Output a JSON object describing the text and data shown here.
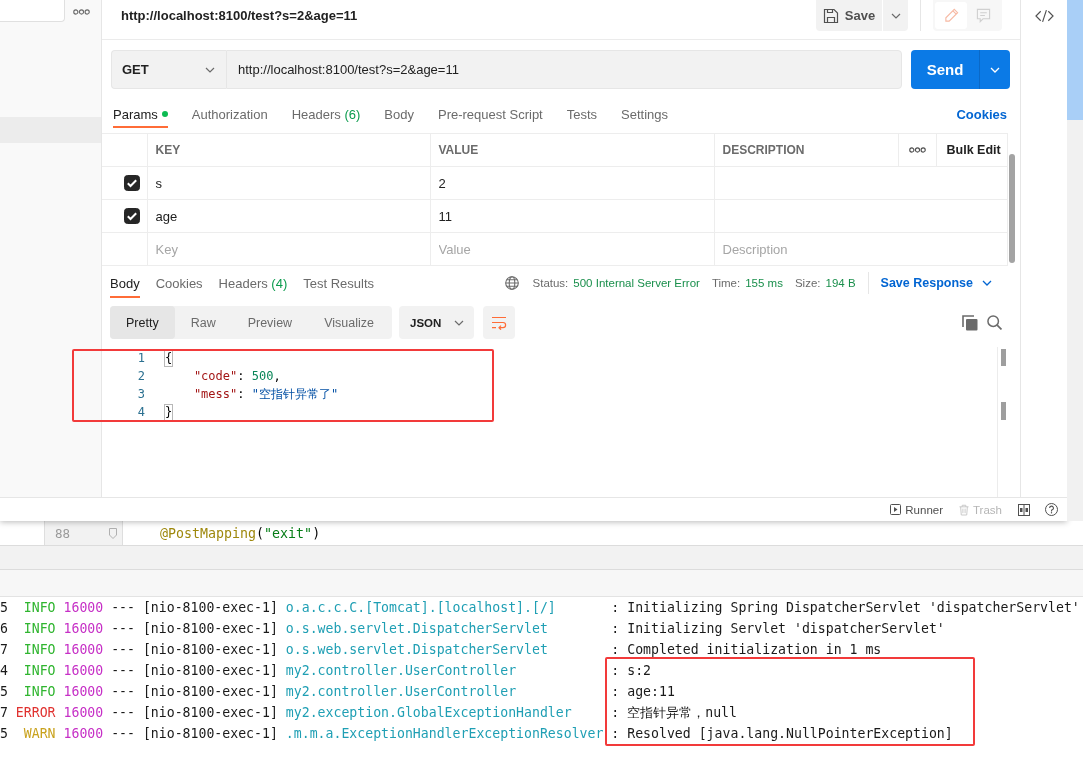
{
  "request": {
    "title": "http://localhost:8100/test?s=2&age=11",
    "save": "Save",
    "method": "GET",
    "url": "http://localhost:8100/test?s=2&age=11",
    "send": "Send"
  },
  "request_tabs": [
    {
      "label": "Params",
      "indicator": true,
      "selected": true
    },
    {
      "label": "Authorization",
      "indicator": false,
      "selected": false
    },
    {
      "label": "Headers",
      "count": "(6)",
      "indicator": false,
      "selected": false
    },
    {
      "label": "Body",
      "indicator": false,
      "selected": false
    },
    {
      "label": "Pre-request Script",
      "indicator": false,
      "selected": false
    },
    {
      "label": "Tests",
      "indicator": false,
      "selected": false
    },
    {
      "label": "Settings",
      "indicator": false,
      "selected": false
    }
  ],
  "cookies_link": "Cookies",
  "params": {
    "columns": [
      "KEY",
      "VALUE",
      "DESCRIPTION"
    ],
    "bulk_edit": "Bulk Edit",
    "rows": [
      {
        "checked": true,
        "key": "s",
        "value": "2"
      },
      {
        "checked": true,
        "key": "age",
        "value": "11"
      }
    ],
    "new_row": [
      {
        "placeholder": "Key"
      },
      {
        "placeholder": "Value"
      },
      {
        "placeholder": "Description"
      }
    ]
  },
  "response": {
    "tabs": [
      {
        "label": "Body",
        "selected": true
      },
      {
        "label": "Cookies",
        "selected": false
      },
      {
        "label": "Headers",
        "count": "(4)",
        "selected": false
      },
      {
        "label": "Test Results",
        "selected": false
      }
    ],
    "meta": [
      {
        "label": "Status:",
        "value": "500 Internal Server Error"
      },
      {
        "label": "Time:",
        "value": "155 ms"
      },
      {
        "label": "Size:",
        "value": "194 B"
      }
    ],
    "save_response": "Save Response",
    "views": [
      {
        "label": "Pretty",
        "selected": true
      },
      {
        "label": "Raw",
        "selected": false
      },
      {
        "label": "Preview",
        "selected": false
      },
      {
        "label": "Visualize",
        "selected": false
      }
    ],
    "format": "JSON",
    "body_lines": [
      {
        "number": "1",
        "tokens": [
          {
            "kind": "bracket",
            "text": "{"
          }
        ],
        "children": [
          {
            "number": "2",
            "tokens": [
              {
                "kind": "key",
                "text": "\"code\""
              },
              {
                "kind": "punct",
                "text": ": "
              },
              {
                "kind": "number",
                "text": "500"
              },
              {
                "kind": "punct",
                "text": ","
              }
            ]
          },
          {
            "number": "3",
            "tokens": [
              {
                "kind": "key",
                "text": "\"mess\""
              },
              {
                "kind": "punct",
                "text": ": "
              },
              {
                "kind": "string",
                "text": "\"空指针异常了\""
              }
            ]
          }
        ]
      },
      {
        "number": "4",
        "tokens": [
          {
            "kind": "bracket",
            "text": "}"
          }
        ]
      }
    ]
  },
  "status_bar": {
    "runner": "Runner",
    "trash": {
      "label": "Trash",
      "disabled": true
    }
  },
  "editor": {
    "line_number": "88",
    "tokens": [
      {
        "kind": "annotation",
        "text": "@PostMapping"
      },
      {
        "kind": "punct",
        "text": "("
      },
      {
        "kind": "string",
        "text": "\"exit\""
      },
      {
        "kind": "punct",
        "text": ")"
      }
    ]
  },
  "console": {
    "rows": [
      {
        "column_1": "5",
        "kind": "info",
        "severity": "INFO",
        "pid": "16000",
        "separator": "---",
        "thread": "[nio-8100-exec-1]",
        "logger": "o.a.c.c.C.[Tomcat].[localhost].[/]",
        "message": ": Initializing Spring DispatcherServlet 'dispatcherServlet'"
      },
      {
        "column_1": "6",
        "kind": "info",
        "severity": "INFO",
        "pid": "16000",
        "separator": "---",
        "thread": "[nio-8100-exec-1]",
        "logger": "o.s.web.servlet.DispatcherServlet",
        "message": ": Initializing Servlet 'dispatcherServlet'"
      },
      {
        "column_1": "7",
        "kind": "info",
        "severity": "INFO",
        "pid": "16000",
        "separator": "---",
        "thread": "[nio-8100-exec-1]",
        "logger": "o.s.web.servlet.DispatcherServlet",
        "message": ": Completed initialization in 1 ms"
      },
      {
        "column_1": "4",
        "kind": "info",
        "severity": "INFO",
        "pid": "16000",
        "separator": "---",
        "thread": "[nio-8100-exec-1]",
        "logger": "my2.controller.UserController",
        "message": ": s:2"
      },
      {
        "column_1": "5",
        "kind": "info",
        "severity": "INFO",
        "pid": "16000",
        "separator": "---",
        "thread": "[nio-8100-exec-1]",
        "logger": "my2.controller.UserController",
        "message": ": age:11"
      },
      {
        "column_1": "7",
        "kind": "error",
        "severity": "ERROR",
        "pid": "16000",
        "separator": "---",
        "thread": "[nio-8100-exec-1]",
        "logger": "my2.exception.GlobalExceptionHandler",
        "message": ": 空指针异常，null"
      },
      {
        "column_1": "5",
        "kind": "warn",
        "severity": "WARN",
        "pid": "16000",
        "separator": "---",
        "thread": "[nio-8100-exec-1]",
        "logger": ".m.m.a.ExceptionHandlerExceptionResolver",
        "message": ": Resolved [java.lang.NullPointerException]"
      }
    ]
  }
}
